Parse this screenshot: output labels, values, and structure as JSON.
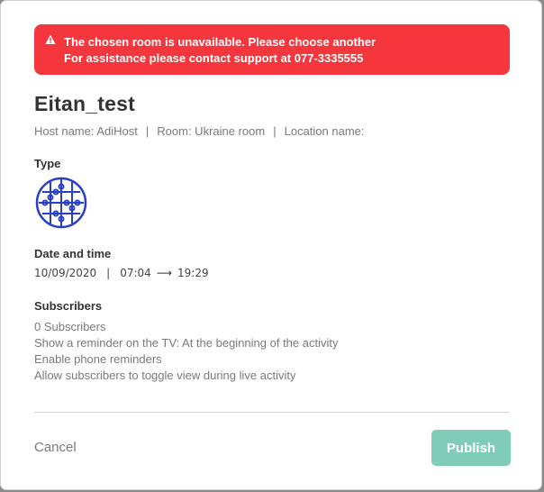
{
  "alert": {
    "line1": "The chosen room is unavailable. Please choose another",
    "line2": "For assistance please contact support at 077-3335555",
    "icon": "warning-icon",
    "color": "#f5363c"
  },
  "event": {
    "title": "Eitan_test",
    "host": "Host name: AdiHost",
    "room": "Room: Ukraine room",
    "location": "Location name:",
    "separator": "|"
  },
  "type": {
    "label": "Type",
    "icon": "puzzle-globe-icon"
  },
  "datetime": {
    "label": "Date and time",
    "date": "10/09/2020",
    "separator": "|",
    "start": "07:04",
    "end": "19:29"
  },
  "subscribers": {
    "label": "Subscribers",
    "lines": [
      "0 Subscribers",
      "Show a reminder on the TV: At the beginning of the activity",
      "Enable phone reminders",
      "Allow subscribers to toggle view during live activity"
    ]
  },
  "footer": {
    "cancel_label": "Cancel",
    "publish_label": "Publish",
    "publish_color": "#7fcdb9"
  }
}
